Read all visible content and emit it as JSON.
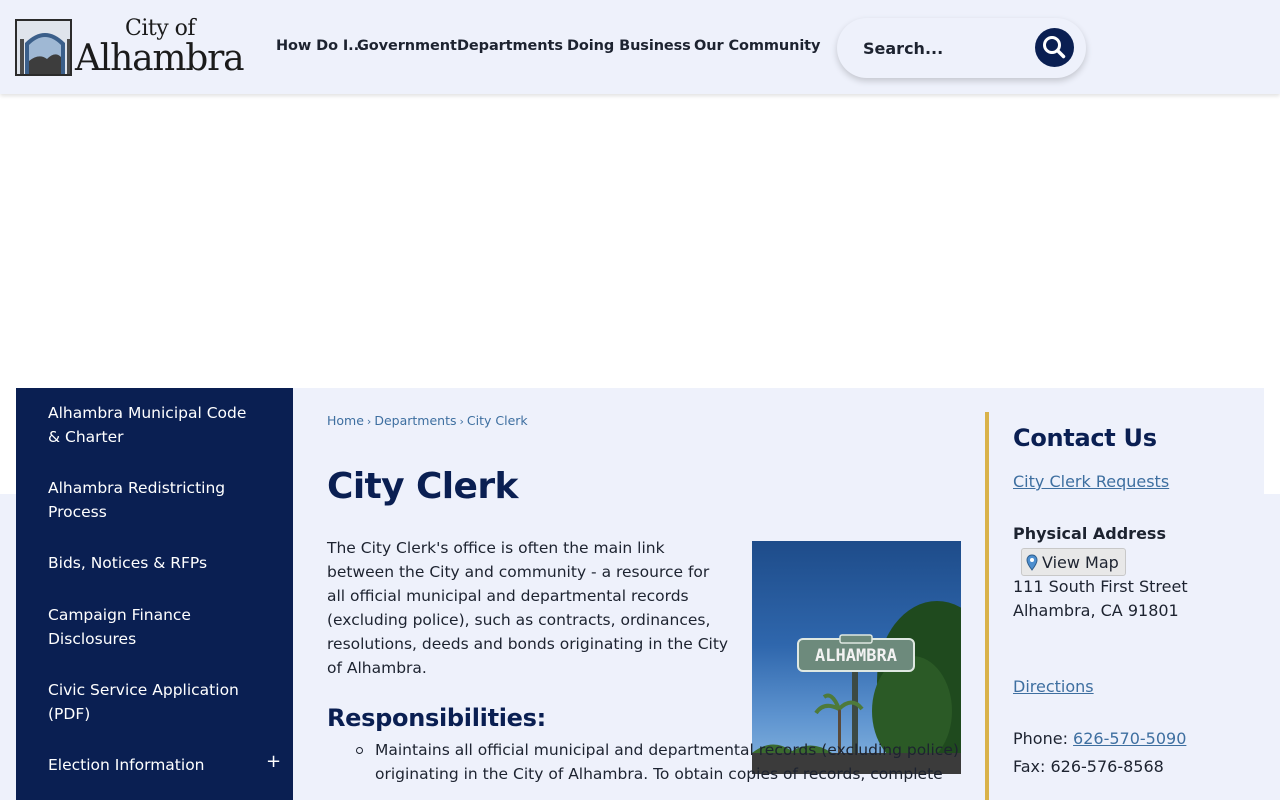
{
  "header": {
    "logo": {
      "city_of": "City of",
      "name": "Alhambra"
    },
    "nav": [
      {
        "label": "How Do I..."
      },
      {
        "label": "Government"
      },
      {
        "label": "Departments"
      },
      {
        "label": "Doing Business"
      },
      {
        "label": "Our Community"
      }
    ],
    "search": {
      "placeholder": "Search..."
    }
  },
  "sidebar": {
    "items": [
      {
        "label": "Alhambra Municipal Code & Charter"
      },
      {
        "label": "Alhambra Redistricting Process"
      },
      {
        "label": "Bids, Notices & RFPs"
      },
      {
        "label": "Campaign Finance Disclosures"
      },
      {
        "label": "Civic Service Application (PDF)"
      },
      {
        "label": "Election Information",
        "toggle": "+"
      }
    ]
  },
  "breadcrumb": {
    "home": "Home",
    "sep": "›",
    "departments": "Departments",
    "current": "City Clerk"
  },
  "main": {
    "title": "City Clerk",
    "intro": "The City Clerk's office is often the main link between the City and community - a resource for all official municipal and departmental records (excluding police), such as contracts, ordinances, resolutions, deeds and bonds originating in the City of Alhambra.",
    "responsibilities_title": "Responsibilities:",
    "responsibilities": [
      "Maintains all official municipal and departmental records (excluding police) originating in the City of Alhambra. To obtain copies of records, complete"
    ],
    "photo_sign_text": "ALHAMBRA"
  },
  "contact": {
    "title": "Contact Us",
    "requests_link": "City Clerk Requests",
    "address_label": "Physical Address",
    "view_map": "View Map",
    "street": "111 South First Street",
    "city_line": "Alhambra, CA 91801",
    "directions": "Directions",
    "phone_label": "Phone:",
    "phone": "626-570-5090",
    "fax": "Fax: 626-576-8568"
  },
  "colors": {
    "navy": "#0a1f52",
    "link": "#3e6fa0",
    "background": "#eef1fb",
    "accent_gold": "#d9b24a"
  }
}
